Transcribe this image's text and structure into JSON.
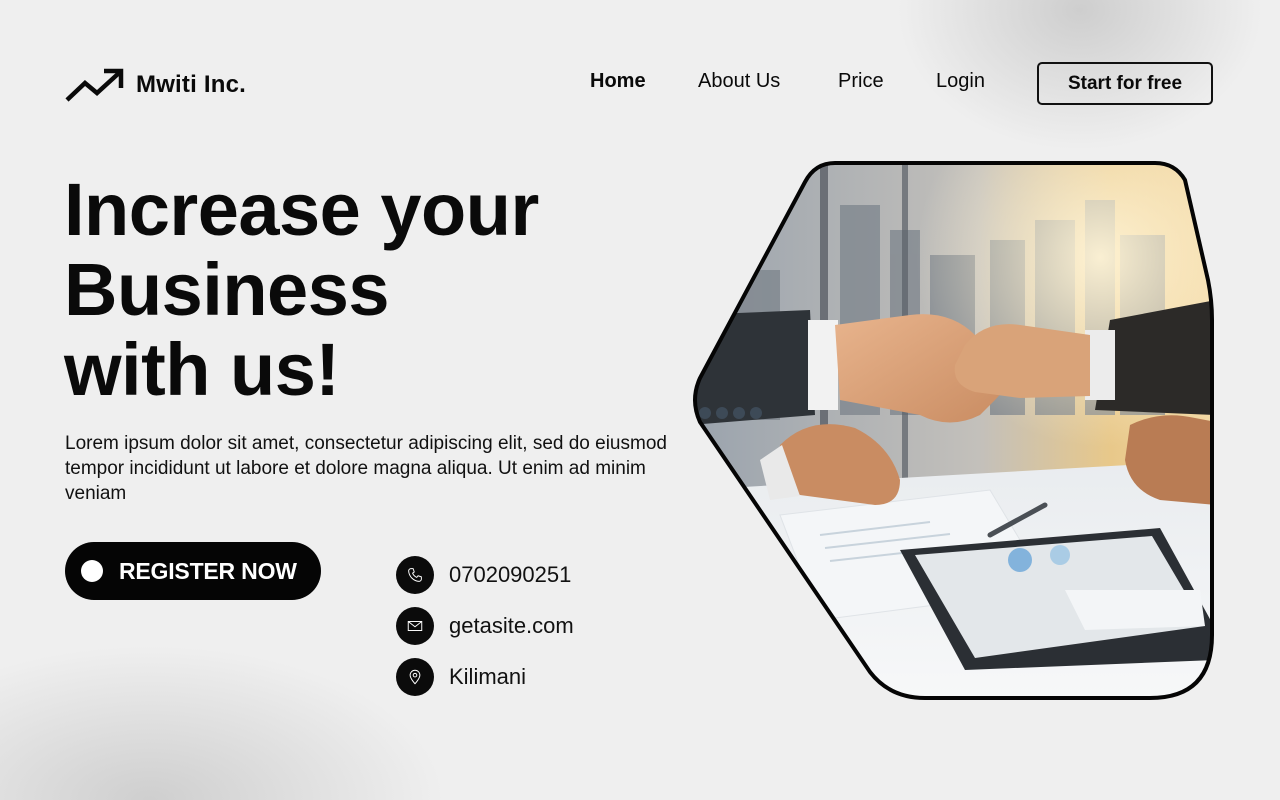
{
  "brand": {
    "name": "Mwiti Inc.",
    "logo_icon": "trend-up-arrow-icon"
  },
  "nav": {
    "items": [
      {
        "label": "Home",
        "active": true
      },
      {
        "label": "About Us",
        "active": false
      },
      {
        "label": "Price",
        "active": false
      },
      {
        "label": "Login",
        "active": false
      }
    ],
    "cta_label": "Start for free"
  },
  "hero": {
    "title_lines": [
      "Increase your",
      "Business",
      "with us!"
    ],
    "description": "Lorem ipsum dolor sit amet, consectetur adipiscing elit, sed do eiusmod tempor incididunt ut labore et dolore magna aliqua. Ut enim ad minim veniam",
    "register_label": "REGISTER NOW",
    "image_alt_icon": "business-handshake-photo"
  },
  "contacts": [
    {
      "icon": "phone-icon",
      "text": "0702090251"
    },
    {
      "icon": "mail-icon",
      "text": "getasite.com"
    },
    {
      "icon": "location-pin-icon",
      "text": "Kilimani"
    }
  ],
  "colors": {
    "background": "#efefef",
    "primary": "#050505",
    "on_primary": "#ffffff"
  }
}
